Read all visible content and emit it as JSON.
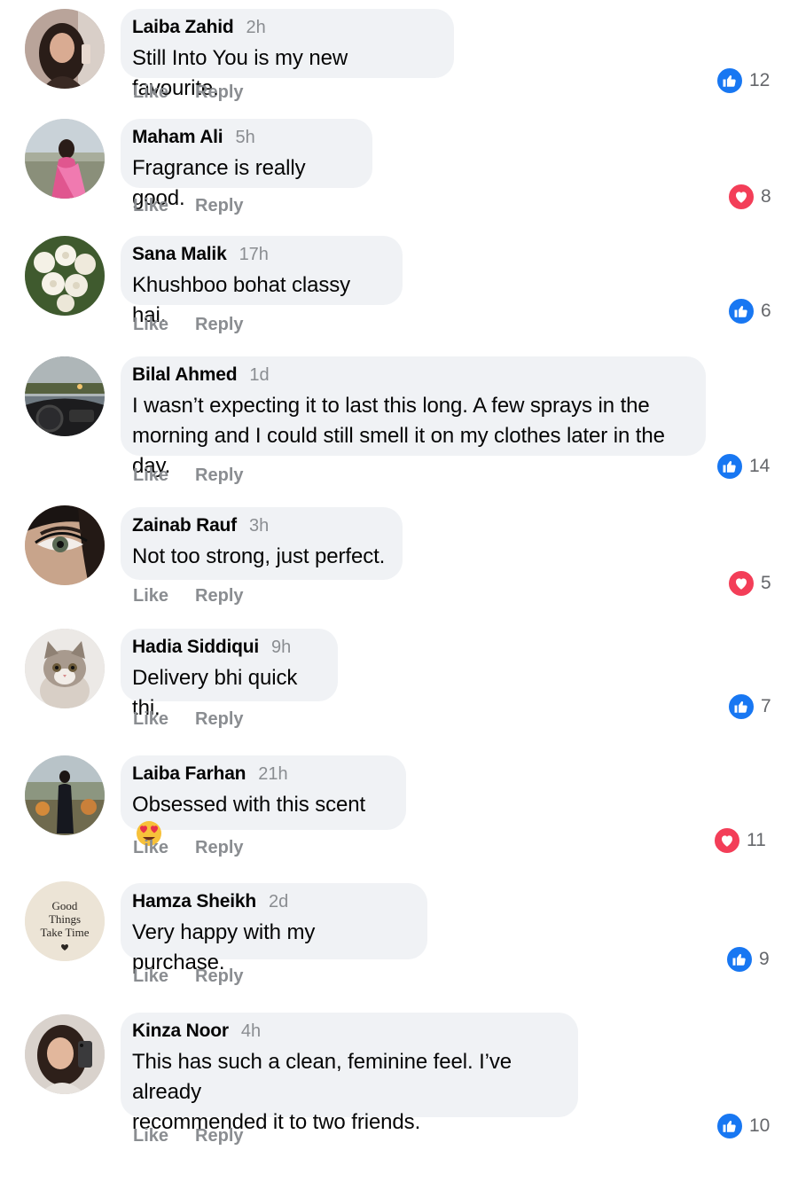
{
  "actions": {
    "like_label": "Like",
    "reply_label": "Reply"
  },
  "colors": {
    "like_blue": "#1877f2",
    "love_red": "#f33e58",
    "bubble_bg": "#f0f2f5",
    "meta_gray": "#8a8d91"
  },
  "comments": [
    {
      "author": "Laiba Zahid",
      "time": "2h",
      "text": "Still Into You is my new favourite.",
      "reaction_icon": "like-icon",
      "reaction_count": "12",
      "avatar": "selfie-girl-avatar"
    },
    {
      "author": "Maham Ali",
      "time": "5h",
      "text": "Fragrance is really good.",
      "reaction_icon": "heart-icon",
      "reaction_count": "8",
      "avatar": "pink-dress-avatar"
    },
    {
      "author": "Sana Malik",
      "time": "17h",
      "text": "Khushboo bohat classy hai.",
      "reaction_icon": "like-icon",
      "reaction_count": "6",
      "avatar": "white-roses-avatar"
    },
    {
      "author": "Bilal Ahmed",
      "time": "1d",
      "text_line1": "I wasn’t expecting it to last this long. A few sprays in the",
      "text_line2": "morning and I could still smell it on my clothes later in the day.",
      "reaction_icon": "like-icon",
      "reaction_count": "14",
      "avatar": "car-dashboard-avatar"
    },
    {
      "author": "Zainab Rauf",
      "time": "3h",
      "text": "Not too strong, just perfect.",
      "reaction_icon": "heart-icon",
      "reaction_count": "5",
      "avatar": "eye-closeup-avatar"
    },
    {
      "author": "Hadia Siddiqui",
      "time": "9h",
      "text": "Delivery bhi quick thi.",
      "reaction_icon": "like-icon",
      "reaction_count": "7",
      "avatar": "kitten-avatar"
    },
    {
      "author": "Laiba Farhan",
      "time": "21h",
      "text": "Obsessed with this scent",
      "emoji": "heart-eyes-emoji",
      "reaction_icon": "heart-icon",
      "reaction_count": "11",
      "avatar": "standing-girl-avatar"
    },
    {
      "author": "Hamza Sheikh",
      "time": "2d",
      "text": "Very happy with my purchase.",
      "reaction_icon": "like-icon",
      "reaction_count": "9",
      "avatar": "good-things-quote-avatar",
      "avatar_text_1": "Good",
      "avatar_text_2": "Things",
      "avatar_text_3": "Take Time"
    },
    {
      "author": "Kinza Noor",
      "time": "4h",
      "text_line1": "This has such a clean, feminine feel. I’ve already",
      "text_line2": "recommended it to two friends.",
      "reaction_icon": "like-icon",
      "reaction_count": "10",
      "avatar": "mirror-selfie-avatar"
    }
  ]
}
